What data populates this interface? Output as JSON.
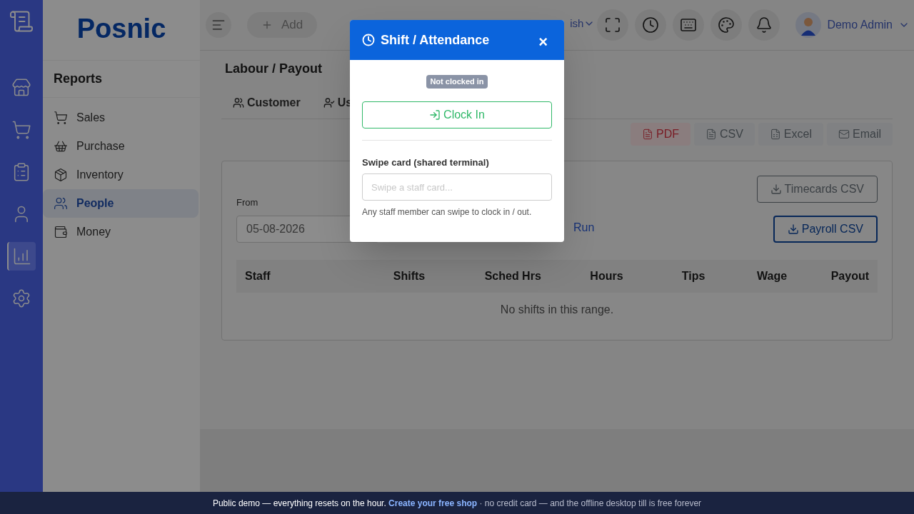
{
  "rail": [
    {
      "kind": "store",
      "selected": false
    },
    {
      "kind": "cart",
      "selected": false
    },
    {
      "kind": "clipboard",
      "selected": false
    },
    {
      "kind": "person",
      "selected": false
    },
    {
      "kind": "chart",
      "selected": true
    },
    {
      "kind": "gear",
      "selected": false
    }
  ],
  "brand": "Posnic",
  "sidebar": {
    "title": "Reports",
    "items": [
      {
        "label": "Sales",
        "kind": "cart",
        "selected": false
      },
      {
        "label": "Purchase",
        "kind": "basket",
        "selected": false
      },
      {
        "label": "Inventory",
        "kind": "box",
        "selected": false
      },
      {
        "label": "People",
        "kind": "people",
        "selected": true
      },
      {
        "label": "Money",
        "kind": "wallet",
        "selected": false
      }
    ]
  },
  "header": {
    "add_label": "Add",
    "language": "ish",
    "user": "Demo Admin"
  },
  "page": {
    "title": "Labour / Payout",
    "tabs": [
      {
        "label": "Customer",
        "kind": "users",
        "selected": false
      },
      {
        "label": "Us",
        "kind": "usercheck",
        "selected": false
      }
    ],
    "exports": [
      {
        "label": "PDF",
        "kind": "pdf"
      },
      {
        "label": "CSV",
        "kind": "csv"
      },
      {
        "label": "Excel",
        "kind": "excel"
      },
      {
        "label": "Email",
        "kind": "email"
      }
    ],
    "from_label": "From",
    "from_value": "05-08-2026",
    "run_label": "Run",
    "downloads": [
      {
        "label": "Timecards CSV",
        "kind": "secondary"
      },
      {
        "label": "Payroll CSV",
        "kind": "primary"
      }
    ],
    "columns": [
      "Staff",
      "Shifts",
      "Sched Hrs",
      "Hours",
      "Tips",
      "Wage",
      "Payout"
    ],
    "empty_message": "No shifts in this range."
  },
  "modal": {
    "title": "Shift / Attendance",
    "close": "×",
    "status": "Not clocked in",
    "clock_in_label": "Clock In",
    "swipe_label": "Swipe card (shared terminal)",
    "swipe_placeholder": "Swipe a staff card...",
    "help": "Any staff member can swipe to clock in / out."
  },
  "banner": {
    "lead": "Public demo — everything resets on the hour.",
    "link": "Create your free shop",
    "tail": "· no credit card — and the offline desktop till is free forever"
  }
}
